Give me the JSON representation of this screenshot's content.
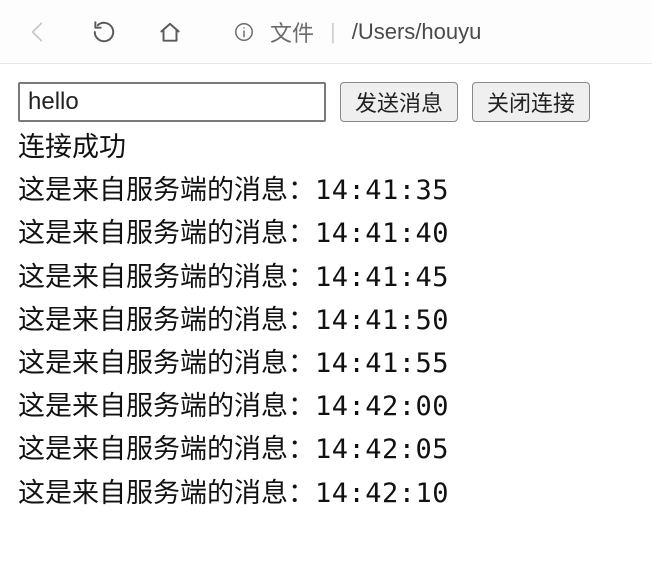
{
  "chrome": {
    "scheme_label": "文件",
    "path": "/Users/houyu"
  },
  "controls": {
    "input_value": "hello",
    "send_label": "发送消息",
    "close_label": "关闭连接"
  },
  "log": {
    "status": "连接成功",
    "prefix": "这是来自服务端的消息：",
    "times": [
      "14:41:35",
      "14:41:40",
      "14:41:45",
      "14:41:50",
      "14:41:55",
      "14:42:00",
      "14:42:05",
      "14:42:10"
    ]
  }
}
